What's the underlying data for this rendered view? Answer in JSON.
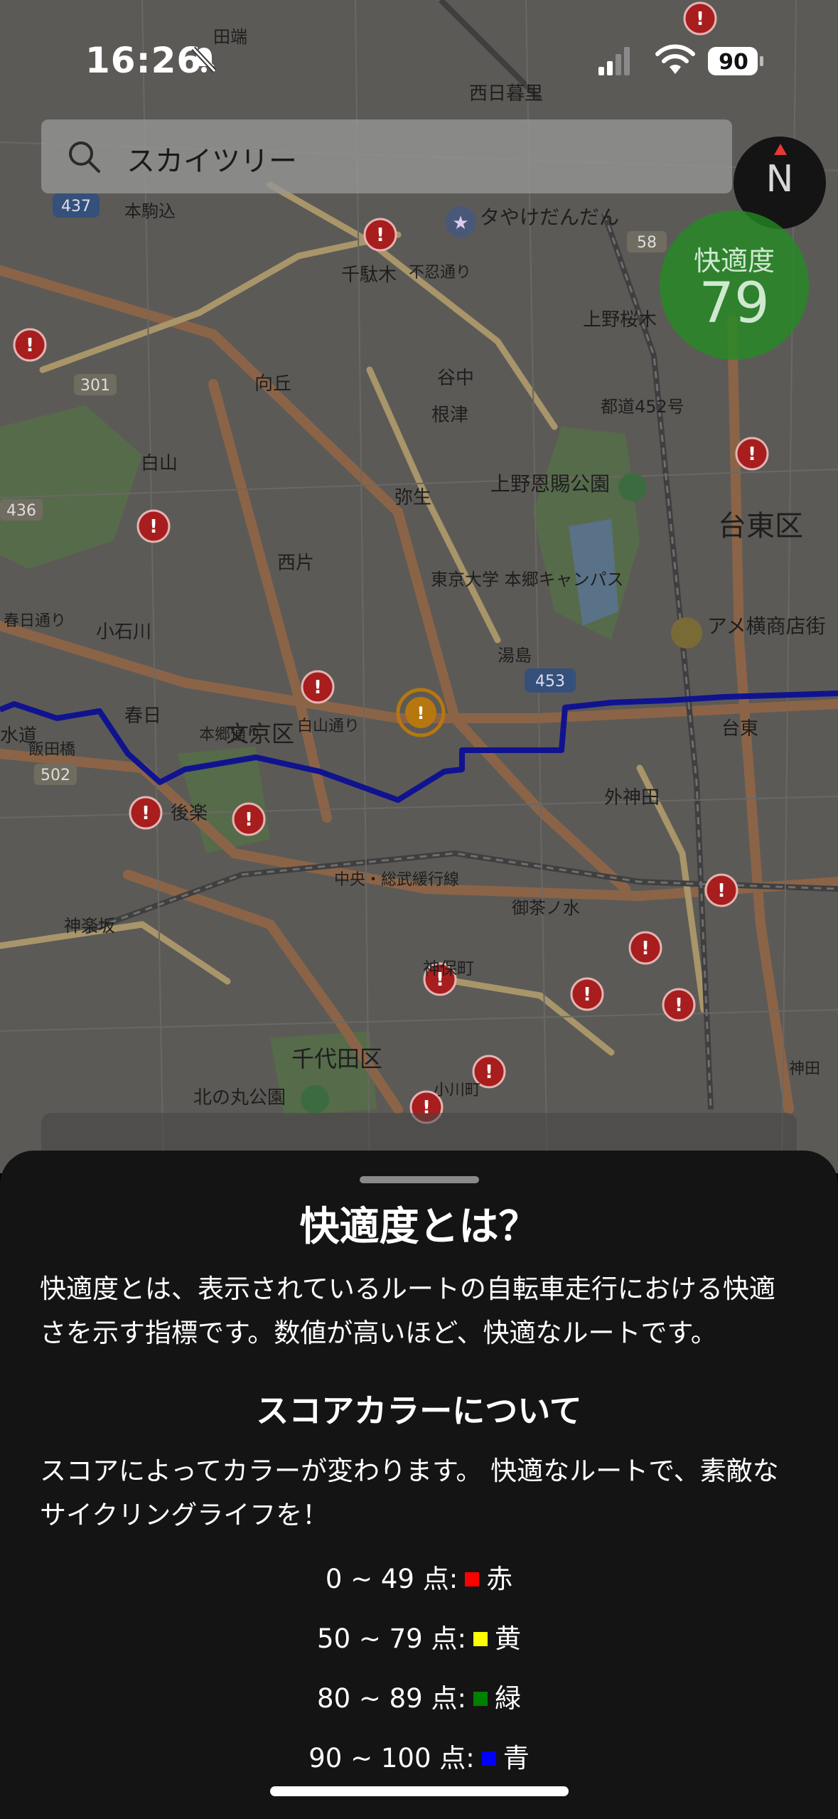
{
  "status_bar": {
    "time": "16:26",
    "battery": "90"
  },
  "search": {
    "value": "スカイツリー"
  },
  "compass": {
    "label": "N"
  },
  "comfort_badge": {
    "label": "快適度",
    "score": "79"
  },
  "map": {
    "labels": [
      "田端",
      "西日暮里",
      "本駒込",
      "千駄木",
      "谷中",
      "根津",
      "向丘",
      "白山",
      "弥生",
      "西片",
      "小石川",
      "春日",
      "文京区",
      "水道",
      "飯田橋",
      "後楽",
      "上野恩賜公園",
      "台東区",
      "上野桜木",
      "湯島",
      "外神田",
      "台東",
      "御茶ノ水",
      "千代田区",
      "北の丸公園",
      "神保町",
      "アメ横商店街",
      "タやけだんだん",
      "都道452号",
      "東京大学 本郷キャンパス",
      "神楽坂",
      "小川町",
      "春日通り",
      "白山通り",
      "本郷通り",
      "不忍通り",
      "中央・総武緩行線",
      "神田"
    ],
    "shields": [
      "437",
      "301",
      "436",
      "453",
      "58",
      "502"
    ]
  },
  "sheet": {
    "title": "快適度とは？",
    "description": "快適度とは、表示されているルートの自転車走行における快適さを示す指標です。数値が高いほど、快適なルートです。",
    "subtitle": "スコアカラーについて",
    "color_description": "スコアによってカラーが変わります。 快適なルートで、素敵なサイクリングライフを！",
    "scores": [
      {
        "range": "0 ~ 49 点:",
        "color_name": "赤",
        "color": "#ff0000"
      },
      {
        "range": "50 ~ 79 点:",
        "color_name": "黄",
        "color": "#ffff00"
      },
      {
        "range": "80 ~ 89 点:",
        "color_name": "緑",
        "color": "#008000"
      },
      {
        "range": "90 ~ 100 点:",
        "color_name": "青",
        "color": "#0000ff"
      }
    ]
  },
  "colors": {
    "route": "#10138f",
    "comfort_badge": "#228c22",
    "warning_marker": "#c81e1e",
    "sheet_bg": "#141414"
  }
}
